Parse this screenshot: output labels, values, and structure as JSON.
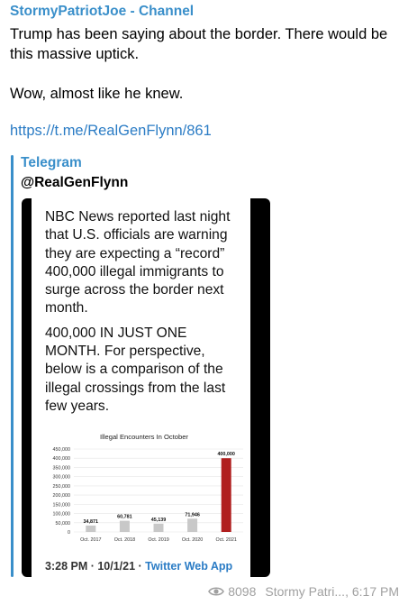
{
  "post": {
    "channel": "StormyPatriotJoe - Channel",
    "text_line1": "Trump has been saying about the border.  There would be this massive uptick.",
    "text_line2": "Wow, almost like he knew.",
    "link": "https://t.me/RealGenFlynn/861"
  },
  "preview": {
    "site": "Telegram",
    "title": "@RealGenFlynn",
    "tweet_para1": "NBC News reported last night that U.S. officials are warning they are expecting a “record” 400,000 illegal immigrants to surge across the border next month.",
    "tweet_para2": "400,000 IN JUST ONE MONTH. For perspective, below is a comparison of the illegal crossings from the last few years.",
    "tweet_time": "3:28 PM · 10/1/21 · ",
    "tweet_via": "Twitter Web App"
  },
  "footer": {
    "views": "8098",
    "author_time": "Stormy Patri..., 6:17 PM",
    "eye_icon": "eye-icon"
  },
  "colors": {
    "accent": "#3a8fca",
    "link": "#2b7cc5",
    "bar_gray": "#c8c8c8",
    "bar_highlight": "#b01e1e"
  },
  "chart_data": {
    "type": "bar",
    "title": "Illegal Encounters In October",
    "categories": [
      "Oct. 2017",
      "Oct. 2018",
      "Oct. 2019",
      "Oct. 2020",
      "Oct. 2021"
    ],
    "values": [
      34871,
      60781,
      45139,
      71946,
      400000
    ],
    "value_labels": [
      "34,871",
      "60,781",
      "45,139",
      "71,946",
      "400,000"
    ],
    "yticks": [
      "0",
      "50,000",
      "100,000",
      "150,000",
      "200,000",
      "250,000",
      "300,000",
      "350,000",
      "400,000",
      "450,000"
    ],
    "ylim": [
      0,
      450000
    ],
    "grid": true
  }
}
